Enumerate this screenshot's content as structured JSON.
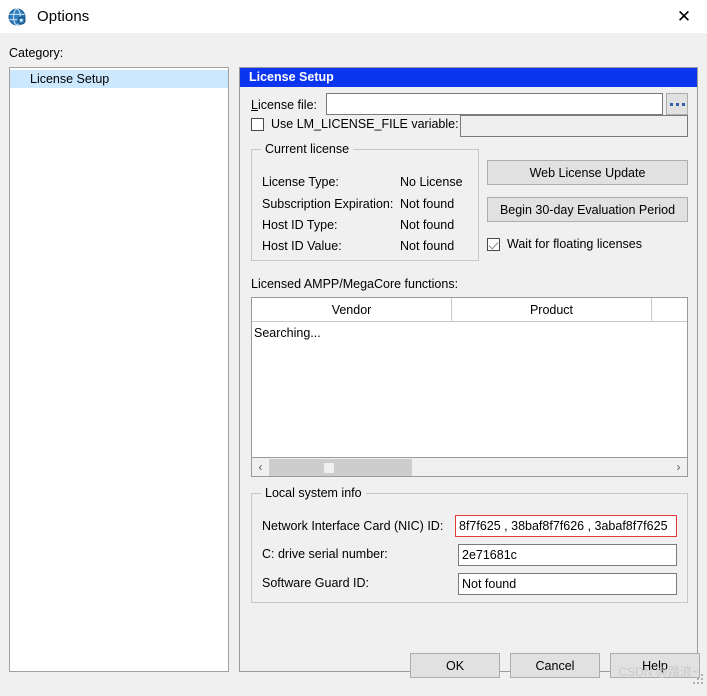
{
  "window": {
    "title": "Options",
    "icon": "quartus-globe-icon",
    "close_label": "✕"
  },
  "sidebar": {
    "label": "Category:",
    "items": [
      {
        "label": "License Setup",
        "selected": true
      }
    ]
  },
  "panel": {
    "header": "License Setup",
    "license_file": {
      "label_prefix": "L",
      "label_rest": "icense file:",
      "value": "",
      "browse_label": "..."
    },
    "lm_license_file": {
      "checkbox_label": "Use LM_LICENSE_FILE variable:",
      "checked": false,
      "value": "",
      "enabled": false
    },
    "current_license": {
      "title": "Current license",
      "rows": [
        {
          "label": "License Type:",
          "value": "No License"
        },
        {
          "label": "Subscription Expiration:",
          "value": "Not found"
        },
        {
          "label": "Host ID Type:",
          "value": "Not found"
        },
        {
          "label": "Host ID Value:",
          "value": "Not found"
        }
      ]
    },
    "actions": {
      "web_license_update": "Web License Update",
      "begin_eval": "Begin 30-day Evaluation Period",
      "wait_floating_label": "Wait for floating licenses",
      "wait_floating_checked": true
    },
    "functions": {
      "label": "Licensed AMPP/MegaCore functions:",
      "columns": [
        "Vendor",
        "Product",
        ""
      ],
      "status": "Searching...",
      "rows": []
    },
    "scrollbar": {
      "left_arrow": "‹",
      "right_arrow": "›"
    },
    "local_system_info": {
      "title": "Local system info",
      "rows": [
        {
          "label": "Network Interface Card (NIC) ID:",
          "value": "8f7f625 , 38baf8f7f626 , 3abaf8f7f625",
          "highlighted": true
        },
        {
          "label": "C: drive serial number:",
          "value": "2e71681c",
          "highlighted": false
        },
        {
          "label": "Software Guard ID:",
          "value": "Not found",
          "highlighted": false
        }
      ]
    }
  },
  "footer": {
    "ok": "OK",
    "cancel": "Cancel",
    "help": "Help"
  },
  "watermark": "CSDN @踏浪~",
  "colors": {
    "panel_header_bg": "#0b35ef",
    "selection_bg": "#cce8ff",
    "highlight_border": "#e03a3a",
    "dialog_bg": "#f0f0f0"
  }
}
